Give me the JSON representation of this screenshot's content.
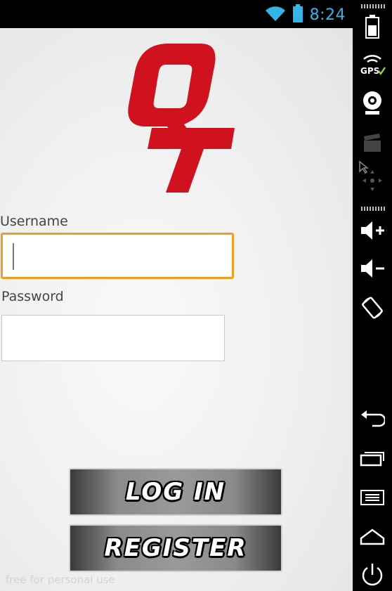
{
  "status_bar": {
    "time": "8:24",
    "icons": [
      "wifi-icon",
      "battery-icon"
    ],
    "accent": "#33b5e5"
  },
  "logo": {
    "text": "QT",
    "color": "#d0121f"
  },
  "form": {
    "username_label": "Username",
    "username_value": "",
    "password_label": "Password",
    "password_value": "",
    "focus_color": "#f29a22"
  },
  "buttons": {
    "login_label": "LOG IN",
    "register_label": "REGISTER"
  },
  "watermark": "free for personal use",
  "emulator_controls": {
    "gps_label": "GPS",
    "items": [
      "battery-icon",
      "gps-icon",
      "camera-icon",
      "video-icon",
      "dpad-icon",
      "volume-up-icon",
      "volume-down-icon",
      "rotate-icon",
      "back-icon",
      "recent-apps-icon",
      "menu-icon",
      "home-icon",
      "power-icon"
    ]
  }
}
